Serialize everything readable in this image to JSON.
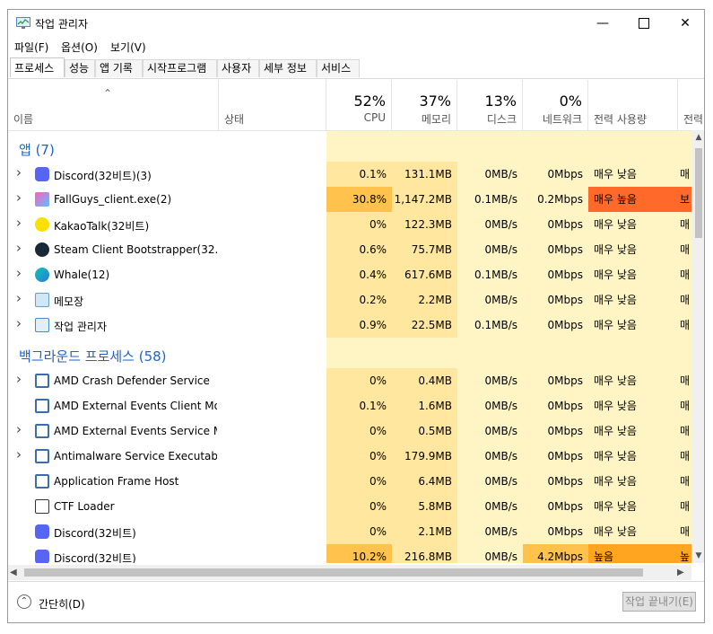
{
  "window": {
    "title": "작업 관리자"
  },
  "menu": [
    "파일(F)",
    "옵션(O)",
    "보기(V)"
  ],
  "tabs": [
    "프로세스",
    "성능",
    "앱 기록",
    "시작프로그램",
    "사용자",
    "세부 정보",
    "서비스"
  ],
  "header": {
    "name": "이름",
    "status": "상태",
    "cpu": {
      "pct": "52%",
      "label": "CPU"
    },
    "memory": {
      "pct": "37%",
      "label": "메모리"
    },
    "disk": {
      "pct": "13%",
      "label": "디스크"
    },
    "network": {
      "pct": "0%",
      "label": "네트워크"
    },
    "power": "전력 사용량",
    "power_trend": "전력"
  },
  "groups": [
    {
      "title": "앱 (7)",
      "rows": [
        {
          "name": "Discord(32비트)(3)",
          "icon": "discord-icon",
          "cpu": "0.1%",
          "mem": "131.1MB",
          "disk": "0MB/s",
          "net": "0Mbps",
          "power": "매우 낮음",
          "trend": "매",
          "expand": true
        },
        {
          "name": "FallGuys_client.exe(2)",
          "icon": "fallguys-icon",
          "cpu": "30.8%",
          "mem": "1,147.2MB",
          "disk": "0.1MB/s",
          "net": "0.2Mbps",
          "power": "매우 높음",
          "trend": "보",
          "expand": true,
          "hot": true
        },
        {
          "name": "KakaoTalk(32비트)",
          "icon": "kakaotalk-icon",
          "cpu": "0%",
          "mem": "122.3MB",
          "disk": "0MB/s",
          "net": "0Mbps",
          "power": "매우 낮음",
          "trend": "매",
          "expand": true
        },
        {
          "name": "Steam Client Bootstrapper(32...",
          "icon": "steam-icon",
          "cpu": "0.6%",
          "mem": "75.7MB",
          "disk": "0MB/s",
          "net": "0Mbps",
          "power": "매우 낮음",
          "trend": "매",
          "expand": true
        },
        {
          "name": "Whale(12)",
          "icon": "whale-icon",
          "cpu": "0.4%",
          "mem": "617.6MB",
          "disk": "0.1MB/s",
          "net": "0Mbps",
          "power": "매우 낮음",
          "trend": "매",
          "expand": true
        },
        {
          "name": "메모장",
          "icon": "notepad-icon",
          "cpu": "0.2%",
          "mem": "2.2MB",
          "disk": "0MB/s",
          "net": "0Mbps",
          "power": "매우 낮음",
          "trend": "매",
          "expand": true
        },
        {
          "name": "작업 관리자",
          "icon": "task-manager-icon",
          "cpu": "0.9%",
          "mem": "22.5MB",
          "disk": "0.1MB/s",
          "net": "0Mbps",
          "power": "매우 낮음",
          "trend": "매",
          "expand": true
        }
      ]
    },
    {
      "title": "백그라운드 프로세스 (58)",
      "rows": [
        {
          "name": "AMD Crash Defender Service",
          "icon": "service-icon",
          "cpu": "0%",
          "mem": "0.4MB",
          "disk": "0MB/s",
          "net": "0Mbps",
          "power": "매우 낮음",
          "trend": "매",
          "expand": true
        },
        {
          "name": "AMD External Events Client Mo...",
          "icon": "service-icon",
          "cpu": "0.1%",
          "mem": "1.6MB",
          "disk": "0MB/s",
          "net": "0Mbps",
          "power": "매우 낮음",
          "trend": "매",
          "expand": false
        },
        {
          "name": "AMD External Events Service M...",
          "icon": "service-icon",
          "cpu": "0%",
          "mem": "0.5MB",
          "disk": "0MB/s",
          "net": "0Mbps",
          "power": "매우 낮음",
          "trend": "매",
          "expand": true
        },
        {
          "name": "Antimalware Service Executable",
          "icon": "service-icon",
          "cpu": "0%",
          "mem": "179.9MB",
          "disk": "0MB/s",
          "net": "0Mbps",
          "power": "매우 낮음",
          "trend": "매",
          "expand": true
        },
        {
          "name": "Application Frame Host",
          "icon": "service-icon",
          "cpu": "0%",
          "mem": "6.4MB",
          "disk": "0MB/s",
          "net": "0Mbps",
          "power": "매우 낮음",
          "trend": "매",
          "expand": false
        },
        {
          "name": "CTF Loader",
          "icon": "ctf-icon",
          "cpu": "0%",
          "mem": "5.8MB",
          "disk": "0MB/s",
          "net": "0Mbps",
          "power": "매우 낮음",
          "trend": "매",
          "expand": false
        },
        {
          "name": "Discord(32비트)",
          "icon": "discord-icon",
          "cpu": "0%",
          "mem": "2.1MB",
          "disk": "0MB/s",
          "net": "0Mbps",
          "power": "매우 낮음",
          "trend": "매",
          "expand": false
        },
        {
          "name": "Discord(32비트)",
          "icon": "discord-icon",
          "cpu": "10.2%",
          "mem": "216.8MB",
          "disk": "0MB/s",
          "net": "4.2Mbps",
          "power": "높음",
          "trend": "높",
          "expand": false,
          "warm": true
        }
      ]
    }
  ],
  "footer": {
    "collapse": "간단히(D)",
    "end_task": "작업 끝내기(E)"
  },
  "colors": {
    "heat_light": "#fff4c4",
    "heat_mid": "#ffe7a0",
    "heat_cpu_high": "#ffc34d",
    "power_very_high": "#ff6a2b",
    "power_high": "#ffa51f",
    "group_blue": "#1f63c5"
  }
}
